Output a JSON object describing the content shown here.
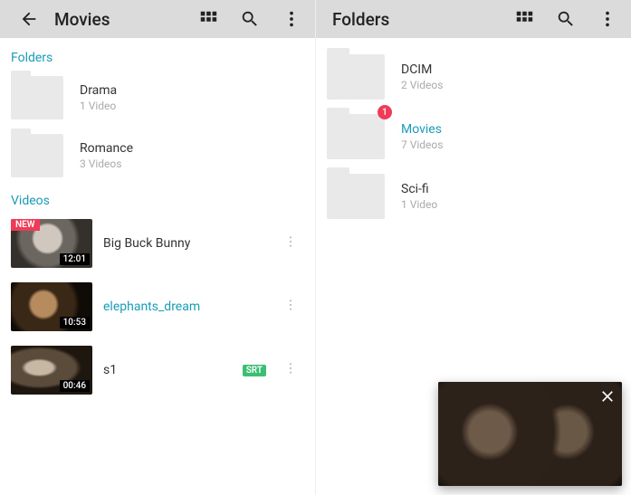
{
  "left": {
    "title": "Movies",
    "sections": {
      "folders_label": "Folders",
      "videos_label": "Videos"
    },
    "folders": [
      {
        "name": "Drama",
        "sub": "1 Video"
      },
      {
        "name": "Romance",
        "sub": "3 Videos"
      }
    ],
    "videos": [
      {
        "title": "Big Buck Bunny",
        "duration": "12:01",
        "new_tag": "NEW",
        "highlight": false,
        "srt": null
      },
      {
        "title": "elephants_dream",
        "duration": "10:53",
        "new_tag": null,
        "highlight": true,
        "srt": null
      },
      {
        "title": "s1",
        "duration": "00:46",
        "new_tag": null,
        "highlight": false,
        "srt": "SRT"
      }
    ]
  },
  "right": {
    "title": "Folders",
    "folders": [
      {
        "name": "DCIM",
        "sub": "2 Videos",
        "badge": null,
        "highlight": false
      },
      {
        "name": "Movies",
        "sub": "7 Videos",
        "badge": "1",
        "highlight": true
      },
      {
        "name": "Sci-fi",
        "sub": "1 Video",
        "badge": null,
        "highlight": false
      }
    ]
  },
  "icons": {
    "grid": "grid-icon",
    "search": "search-icon",
    "more": "more-vert-icon",
    "back": "back-icon",
    "close": "close-icon"
  }
}
